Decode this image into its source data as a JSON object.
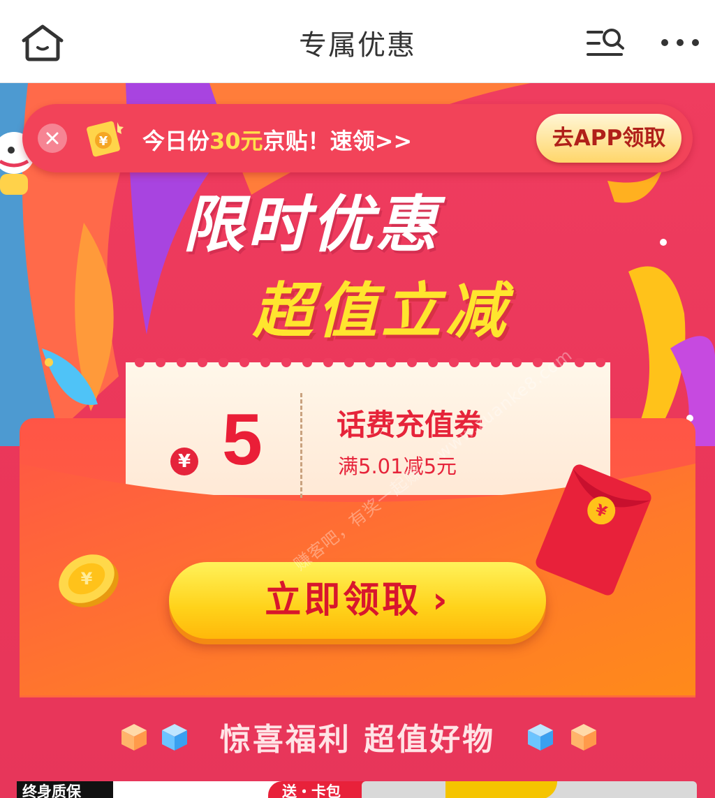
{
  "topbar": {
    "title": "专属优惠",
    "icons": [
      "home-icon",
      "search-list-icon",
      "more-icon"
    ]
  },
  "notice": {
    "text_before": "今日份",
    "text_highlight": "30元",
    "text_after": "京贴！速领>>",
    "app_button": "去APP领取"
  },
  "hero": {
    "headline": "限时优惠",
    "subheadline": "超值立减"
  },
  "coupon": {
    "currency": "¥",
    "amount": "5",
    "title": "话费充值券",
    "condition": "满5.01减5元"
  },
  "claim_button": {
    "label": "立即领取",
    "chevron": "›"
  },
  "section": {
    "title": "惊喜福利 超值好物"
  },
  "cards": {
    "left_tag": "终身质保",
    "left_badge": "送・卡包"
  },
  "watermark": "赚客吧，有奖一起赚！ www.zuanke8.com",
  "colors": {
    "accent_red": "#e83a5a",
    "yellow": "#ffe52e",
    "button_red_text": "#d8162d"
  }
}
